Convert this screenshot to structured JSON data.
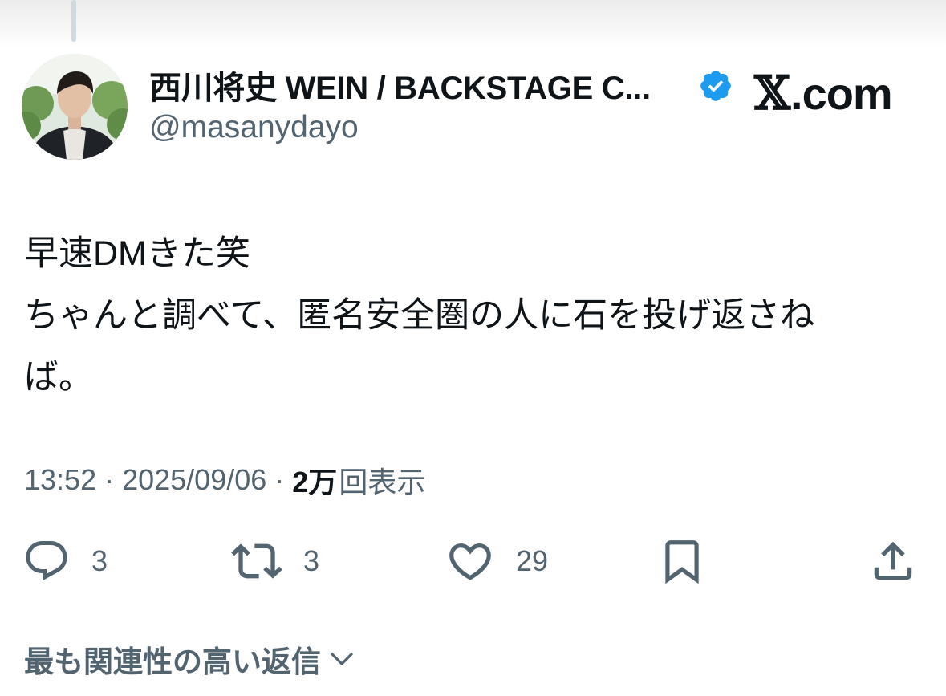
{
  "author": {
    "display_name": "西川将史 WEIN / BACKSTAGE C...",
    "handle": "@masanydayo",
    "verified": true,
    "verified_color": "#1d9bf0"
  },
  "site_label": {
    "glyph": "𝕏",
    "text": ".com"
  },
  "tweet": {
    "lines": [
      "早速DMきた笑",
      "ちゃんと調べて、匿名安全圏の人に石を投げ返さね",
      "ば。"
    ],
    "time": "13:52",
    "date": "2025/09/06",
    "separator": "·",
    "views_count": "2万",
    "views_label": "回表示"
  },
  "actions": {
    "reply": {
      "icon": "reply-icon",
      "count": "3"
    },
    "retweet": {
      "icon": "retweet-icon",
      "count": "3"
    },
    "like": {
      "icon": "heart-icon",
      "count": "29"
    },
    "bookmark": {
      "icon": "bookmark-icon"
    },
    "share": {
      "icon": "share-icon"
    }
  },
  "replies_sort": {
    "label": "最も関連性の高い返信",
    "icon": "chevron-down-icon"
  },
  "colors": {
    "text_primary": "#0f1419",
    "text_secondary": "#536471",
    "thread_line": "#cfd9de"
  }
}
